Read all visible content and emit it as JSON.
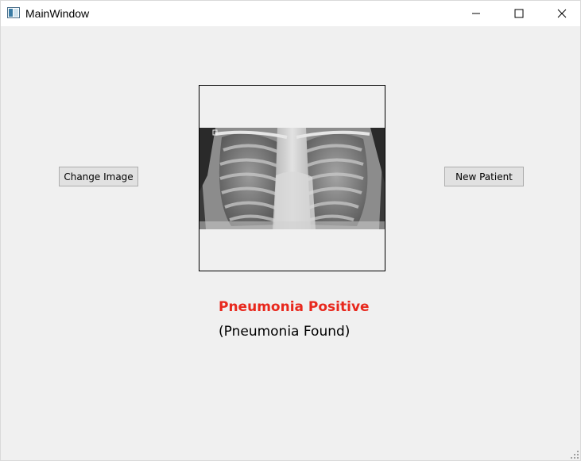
{
  "window": {
    "title": "MainWindow"
  },
  "buttons": {
    "change_image": "Change Image",
    "new_patient": "New Patient"
  },
  "result": {
    "label": "Pneumonia Positive",
    "detail": "(Pneumonia Found)"
  },
  "colors": {
    "result_positive": "#e8281d",
    "window_bg": "#f0f0f0",
    "titlebar_bg": "#ffffff"
  },
  "icons": {
    "app": "app-window-icon",
    "minimize": "minimize-icon",
    "maximize": "maximize-icon",
    "close": "close-icon",
    "resize_grip": "resize-grip-icon"
  }
}
